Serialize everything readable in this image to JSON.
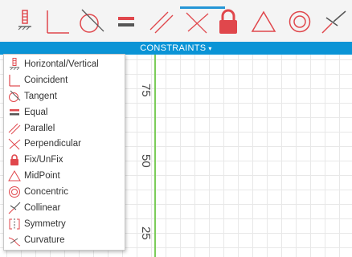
{
  "toolbar": {
    "tools": [
      {
        "name": "horizontal-vertical-icon"
      },
      {
        "name": "coincident-icon"
      },
      {
        "name": "tangent-icon"
      },
      {
        "name": "equal-icon"
      },
      {
        "name": "parallel-icon"
      },
      {
        "name": "perpendicular-icon"
      },
      {
        "name": "lock-icon"
      },
      {
        "name": "midpoint-icon"
      },
      {
        "name": "concentric-icon"
      },
      {
        "name": "collinear-icon"
      }
    ]
  },
  "constraints_bar": {
    "label": "CONSTRAINTS",
    "caret": "▾"
  },
  "menu": {
    "items": [
      {
        "label": "Horizontal/Vertical",
        "icon": "horizontal-vertical-icon"
      },
      {
        "label": "Coincident",
        "icon": "coincident-icon"
      },
      {
        "label": "Tangent",
        "icon": "tangent-icon"
      },
      {
        "label": "Equal",
        "icon": "equal-icon"
      },
      {
        "label": "Parallel",
        "icon": "parallel-icon"
      },
      {
        "label": "Perpendicular",
        "icon": "perpendicular-icon"
      },
      {
        "label": "Fix/UnFix",
        "icon": "lock-icon"
      },
      {
        "label": "MidPoint",
        "icon": "midpoint-icon"
      },
      {
        "label": "Concentric",
        "icon": "concentric-icon"
      },
      {
        "label": "Collinear",
        "icon": "collinear-icon"
      },
      {
        "label": "Symmetry",
        "icon": "symmetry-icon"
      },
      {
        "label": "Curvature",
        "icon": "curvature-icon"
      }
    ]
  },
  "canvas": {
    "axis_labels": [
      "75",
      "50",
      "25"
    ]
  },
  "colors": {
    "accent_blue": "#0a94d6",
    "icon_red": "#e0474c",
    "axis_green": "#7ccc5a"
  }
}
